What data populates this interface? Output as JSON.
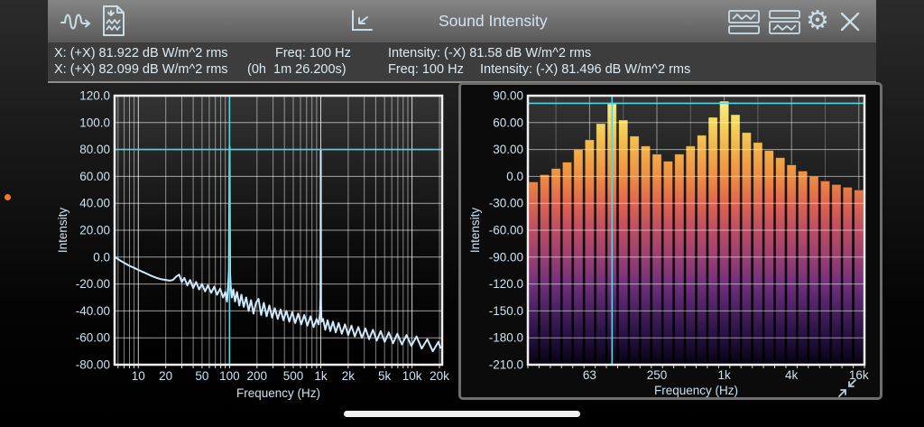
{
  "topbar": {
    "title": "Sound Intensity",
    "icons": [
      "signal-generator",
      "record-to-file",
      "cursor-axes",
      "split-view-top",
      "split-view-bottom",
      "settings-gear",
      "close"
    ]
  },
  "infobar": {
    "row1": [
      "X: (+X) 81.922 dB W/m^2 rms",
      "Freq: 100 Hz",
      "Intensity: (-X) 81.58 dB W/m^2 rms"
    ],
    "row2": [
      "X: (+X) 82.099 dB W/m^2 rms",
      "(0h  1m 26.200s)",
      "Freq: 100 Hz",
      "Intensity: (-X) 81.496 dB W/m^2 rms"
    ]
  },
  "colors": {
    "cursor": "#54d6e2",
    "trace": "#cfe9fa",
    "axis_text": "#cde2f0",
    "grid": "#ffffff",
    "icon": "#c9dde8"
  },
  "chart_data": [
    {
      "type": "line",
      "title": "FFT intensity spectrum",
      "xlabel": "Frequency (Hz)",
      "ylabel": "Intensity",
      "xscale": "log",
      "xlim": [
        5.5,
        21400
      ],
      "ylim": [
        -80,
        120
      ],
      "ytick_labels": [
        "120.0",
        "100.0",
        "80.00",
        "60.00",
        "40.00",
        "20.00",
        "0.0",
        "-20.00",
        "-40.00",
        "-60.00",
        "-80.00"
      ],
      "xticks": [
        10,
        20,
        50,
        100,
        200,
        500,
        1000,
        2000,
        5000,
        10000,
        20000
      ],
      "xtick_labels": [
        "10",
        "20",
        "50",
        "100",
        "200",
        "500",
        "1k",
        "2k",
        "5k",
        "10k",
        "20k"
      ],
      "minor_xticks": [
        6,
        7,
        8,
        9,
        10,
        20,
        30,
        40,
        50,
        60,
        70,
        80,
        90,
        100,
        200,
        300,
        400,
        500,
        600,
        700,
        800,
        900,
        1000,
        2000,
        3000,
        4000,
        5000,
        6000,
        7000,
        8000,
        9000,
        10000,
        20000
      ],
      "cursor": {
        "freq_hz": 100,
        "level_db": 80
      },
      "series": [
        {
          "name": "intensity-spectrum",
          "points": [
            [
              5.6,
              0
            ],
            [
              6.3,
              -2.5
            ],
            [
              7.1,
              -4.5
            ],
            [
              8,
              -6.5
            ],
            [
              9,
              -8
            ],
            [
              10,
              -9.5
            ],
            [
              11.2,
              -11
            ],
            [
              12.5,
              -12.5
            ],
            [
              14,
              -14
            ],
            [
              16,
              -15.5
            ],
            [
              18,
              -16.5
            ],
            [
              20,
              -17
            ],
            [
              22,
              -17.5
            ],
            [
              24,
              -17
            ],
            [
              26,
              -14.5
            ],
            [
              28,
              -13
            ],
            [
              30,
              -18.5
            ],
            [
              32,
              -15.5
            ],
            [
              34.5,
              -21
            ],
            [
              37,
              -17
            ],
            [
              40,
              -23
            ],
            [
              43,
              -18.5
            ],
            [
              46.5,
              -24
            ],
            [
              50,
              -20
            ],
            [
              54,
              -25.5
            ],
            [
              58,
              -21
            ],
            [
              63,
              -26.5
            ],
            [
              68,
              -22
            ],
            [
              73,
              -28
            ],
            [
              79,
              -23.5
            ],
            [
              85,
              -30
            ],
            [
              90,
              -26
            ],
            [
              94,
              -33
            ],
            [
              97,
              -20
            ],
            [
              98.5,
              -10
            ],
            [
              100,
              82
            ],
            [
              101.5,
              -12
            ],
            [
              103,
              -22
            ],
            [
              106,
              -30
            ],
            [
              110,
              -24
            ],
            [
              115,
              -33
            ],
            [
              121,
              -26
            ],
            [
              128,
              -36
            ],
            [
              135,
              -28
            ],
            [
              143,
              -37
            ],
            [
              152,
              -30
            ],
            [
              162,
              -40
            ],
            [
              172,
              -32
            ],
            [
              183,
              -42
            ],
            [
              195,
              -34
            ],
            [
              208,
              -31
            ],
            [
              222,
              -43
            ],
            [
              238,
              -34
            ],
            [
              255,
              -44
            ],
            [
              273,
              -36
            ],
            [
              293,
              -45
            ],
            [
              314,
              -38
            ],
            [
              338,
              -46
            ],
            [
              363,
              -39
            ],
            [
              390,
              -47
            ],
            [
              420,
              -40
            ],
            [
              452,
              -48
            ],
            [
              487,
              -41
            ],
            [
              525,
              -49
            ],
            [
              566,
              -42
            ],
            [
              611,
              -50
            ],
            [
              660,
              -43
            ],
            [
              713,
              -51
            ],
            [
              771,
              -44
            ],
            [
              834,
              -52
            ],
            [
              902,
              -46
            ],
            [
              950,
              -50
            ],
            [
              980,
              -42
            ],
            [
              993,
              -30
            ],
            [
              1000,
              80
            ],
            [
              1007,
              -35
            ],
            [
              1020,
              -48
            ],
            [
              1060,
              -46
            ],
            [
              1120,
              -54
            ],
            [
              1190,
              -47
            ],
            [
              1270,
              -55
            ],
            [
              1360,
              -48
            ],
            [
              1460,
              -56
            ],
            [
              1570,
              -49
            ],
            [
              1700,
              -57
            ],
            [
              1840,
              -50
            ],
            [
              2000,
              -58
            ],
            [
              2170,
              -51
            ],
            [
              2360,
              -59
            ],
            [
              2580,
              -52
            ],
            [
              2820,
              -60
            ],
            [
              3090,
              -53
            ],
            [
              3390,
              -61
            ],
            [
              3730,
              -54
            ],
            [
              4110,
              -62
            ],
            [
              4540,
              -55
            ],
            [
              5020,
              -63
            ],
            [
              5570,
              -56
            ],
            [
              6200,
              -64
            ],
            [
              6920,
              -57
            ],
            [
              7750,
              -65
            ],
            [
              8710,
              -58
            ],
            [
              9840,
              -66
            ],
            [
              11200,
              -59
            ],
            [
              12800,
              -68
            ],
            [
              14700,
              -61
            ],
            [
              16900,
              -70
            ],
            [
              19500,
              -63
            ],
            [
              20600,
              -68
            ]
          ]
        }
      ]
    },
    {
      "type": "bar",
      "title": "Third-octave intensity spectrum",
      "xlabel": "Frequency (Hz)",
      "ylabel": "Intensity",
      "ylim": [
        -210,
        90
      ],
      "ytick_labels": [
        "90.00",
        "60.00",
        "30.00",
        "0.0",
        "-30.00",
        "-60.00",
        "-90.00",
        "-120.0",
        "-150.0",
        "-180.0",
        "-210.0"
      ],
      "categories": [
        "20",
        "25",
        "31.5",
        "40",
        "50",
        "63",
        "80",
        "100",
        "125",
        "160",
        "200",
        "250",
        "315",
        "400",
        "500",
        "630",
        "800",
        "1k",
        "1.25k",
        "1.6k",
        "2k",
        "2.5k",
        "3.15k",
        "4k",
        "5k",
        "6.3k",
        "8k",
        "10k",
        "12.5k",
        "16k"
      ],
      "values": [
        -6,
        2,
        9,
        16,
        30,
        41,
        59,
        81,
        63,
        45,
        34,
        25,
        17,
        25,
        34,
        46,
        66,
        84,
        69,
        49,
        38,
        29,
        21,
        13,
        6,
        0,
        -5,
        -9,
        -12,
        -15
      ],
      "xtick_bands": [
        6,
        12,
        18,
        24,
        30
      ],
      "xtick_labels": [
        "63",
        "250",
        "1k",
        "4k",
        "16k"
      ],
      "minor_grid_bands": [
        3,
        9,
        15,
        21,
        27
      ],
      "cursor": {
        "band_label": "100",
        "level_db": 81.5
      },
      "gradient_stops": [
        "#faf3a0",
        "#f4d75e",
        "#f2b14b",
        "#ee8e43",
        "#de6550",
        "#bc4d63",
        "#9b3f72",
        "#71307d",
        "#48205f",
        "#241040",
        "#070310"
      ]
    }
  ]
}
